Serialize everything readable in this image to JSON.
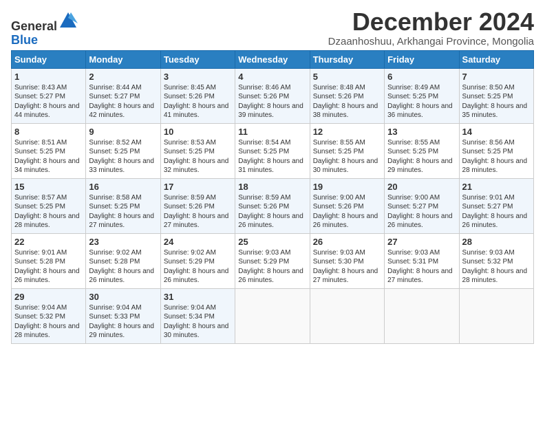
{
  "header": {
    "logo_line1": "General",
    "logo_line2": "Blue",
    "month_title": "December 2024",
    "subtitle": "Dzaanhoshuu, Arkhangai Province, Mongolia"
  },
  "weekdays": [
    "Sunday",
    "Monday",
    "Tuesday",
    "Wednesday",
    "Thursday",
    "Friday",
    "Saturday"
  ],
  "weeks": [
    [
      {
        "day": "1",
        "sunrise": "8:43 AM",
        "sunset": "5:27 PM",
        "daylight": "8 hours and 44 minutes."
      },
      {
        "day": "2",
        "sunrise": "8:44 AM",
        "sunset": "5:27 PM",
        "daylight": "8 hours and 42 minutes."
      },
      {
        "day": "3",
        "sunrise": "8:45 AM",
        "sunset": "5:26 PM",
        "daylight": "8 hours and 41 minutes."
      },
      {
        "day": "4",
        "sunrise": "8:46 AM",
        "sunset": "5:26 PM",
        "daylight": "8 hours and 39 minutes."
      },
      {
        "day": "5",
        "sunrise": "8:48 AM",
        "sunset": "5:26 PM",
        "daylight": "8 hours and 38 minutes."
      },
      {
        "day": "6",
        "sunrise": "8:49 AM",
        "sunset": "5:25 PM",
        "daylight": "8 hours and 36 minutes."
      },
      {
        "day": "7",
        "sunrise": "8:50 AM",
        "sunset": "5:25 PM",
        "daylight": "8 hours and 35 minutes."
      }
    ],
    [
      {
        "day": "8",
        "sunrise": "8:51 AM",
        "sunset": "5:25 PM",
        "daylight": "8 hours and 34 minutes."
      },
      {
        "day": "9",
        "sunrise": "8:52 AM",
        "sunset": "5:25 PM",
        "daylight": "8 hours and 33 minutes."
      },
      {
        "day": "10",
        "sunrise": "8:53 AM",
        "sunset": "5:25 PM",
        "daylight": "8 hours and 32 minutes."
      },
      {
        "day": "11",
        "sunrise": "8:54 AM",
        "sunset": "5:25 PM",
        "daylight": "8 hours and 31 minutes."
      },
      {
        "day": "12",
        "sunrise": "8:55 AM",
        "sunset": "5:25 PM",
        "daylight": "8 hours and 30 minutes."
      },
      {
        "day": "13",
        "sunrise": "8:55 AM",
        "sunset": "5:25 PM",
        "daylight": "8 hours and 29 minutes."
      },
      {
        "day": "14",
        "sunrise": "8:56 AM",
        "sunset": "5:25 PM",
        "daylight": "8 hours and 28 minutes."
      }
    ],
    [
      {
        "day": "15",
        "sunrise": "8:57 AM",
        "sunset": "5:25 PM",
        "daylight": "8 hours and 28 minutes."
      },
      {
        "day": "16",
        "sunrise": "8:58 AM",
        "sunset": "5:25 PM",
        "daylight": "8 hours and 27 minutes."
      },
      {
        "day": "17",
        "sunrise": "8:59 AM",
        "sunset": "5:26 PM",
        "daylight": "8 hours and 27 minutes."
      },
      {
        "day": "18",
        "sunrise": "8:59 AM",
        "sunset": "5:26 PM",
        "daylight": "8 hours and 26 minutes."
      },
      {
        "day": "19",
        "sunrise": "9:00 AM",
        "sunset": "5:26 PM",
        "daylight": "8 hours and 26 minutes."
      },
      {
        "day": "20",
        "sunrise": "9:00 AM",
        "sunset": "5:27 PM",
        "daylight": "8 hours and 26 minutes."
      },
      {
        "day": "21",
        "sunrise": "9:01 AM",
        "sunset": "5:27 PM",
        "daylight": "8 hours and 26 minutes."
      }
    ],
    [
      {
        "day": "22",
        "sunrise": "9:01 AM",
        "sunset": "5:28 PM",
        "daylight": "8 hours and 26 minutes."
      },
      {
        "day": "23",
        "sunrise": "9:02 AM",
        "sunset": "5:28 PM",
        "daylight": "8 hours and 26 minutes."
      },
      {
        "day": "24",
        "sunrise": "9:02 AM",
        "sunset": "5:29 PM",
        "daylight": "8 hours and 26 minutes."
      },
      {
        "day": "25",
        "sunrise": "9:03 AM",
        "sunset": "5:29 PM",
        "daylight": "8 hours and 26 minutes."
      },
      {
        "day": "26",
        "sunrise": "9:03 AM",
        "sunset": "5:30 PM",
        "daylight": "8 hours and 27 minutes."
      },
      {
        "day": "27",
        "sunrise": "9:03 AM",
        "sunset": "5:31 PM",
        "daylight": "8 hours and 27 minutes."
      },
      {
        "day": "28",
        "sunrise": "9:03 AM",
        "sunset": "5:32 PM",
        "daylight": "8 hours and 28 minutes."
      }
    ],
    [
      {
        "day": "29",
        "sunrise": "9:04 AM",
        "sunset": "5:32 PM",
        "daylight": "8 hours and 28 minutes."
      },
      {
        "day": "30",
        "sunrise": "9:04 AM",
        "sunset": "5:33 PM",
        "daylight": "8 hours and 29 minutes."
      },
      {
        "day": "31",
        "sunrise": "9:04 AM",
        "sunset": "5:34 PM",
        "daylight": "8 hours and 30 minutes."
      },
      null,
      null,
      null,
      null
    ]
  ]
}
